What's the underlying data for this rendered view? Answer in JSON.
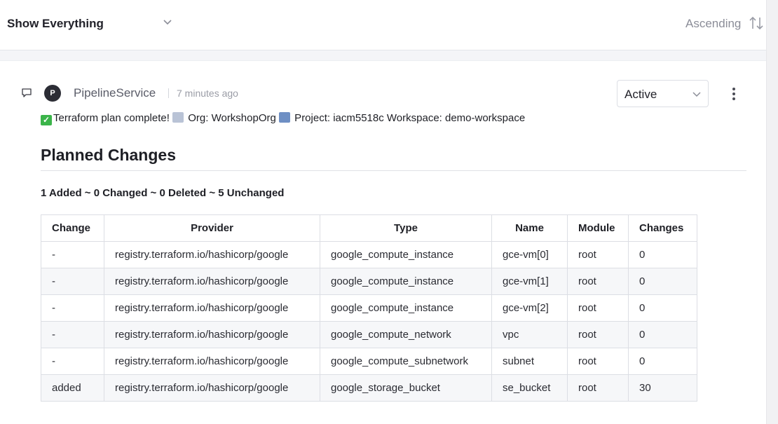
{
  "filter": {
    "label": "Show Everything"
  },
  "sort": {
    "label": "Ascending"
  },
  "comment": {
    "avatar_initial": "P",
    "author": "PipelineService",
    "time": "7 minutes ago",
    "status": "Active",
    "message": {
      "part1": "Terraform plan complete! ",
      "part2": " Org: WorkshopOrg ",
      "part3": " Project: iacm5518c Workspace: demo-workspace"
    },
    "heading": "Planned Changes",
    "summary": "1 Added ~ 0 Changed ~ 0 Deleted ~ 5 Unchanged"
  },
  "table": {
    "headers": [
      "Change",
      "Provider",
      "Type",
      "Name",
      "Module",
      "Changes"
    ],
    "rows": [
      [
        "-",
        "registry.terraform.io/hashicorp/google",
        "google_compute_instance",
        "gce-vm[0]",
        "root",
        "0"
      ],
      [
        "-",
        "registry.terraform.io/hashicorp/google",
        "google_compute_instance",
        "gce-vm[1]",
        "root",
        "0"
      ],
      [
        "-",
        "registry.terraform.io/hashicorp/google",
        "google_compute_instance",
        "gce-vm[2]",
        "root",
        "0"
      ],
      [
        "-",
        "registry.terraform.io/hashicorp/google",
        "google_compute_network",
        "vpc",
        "root",
        "0"
      ],
      [
        "-",
        "registry.terraform.io/hashicorp/google",
        "google_compute_subnetwork",
        "subnet",
        "root",
        "0"
      ],
      [
        "added",
        "registry.terraform.io/hashicorp/google",
        "google_storage_bucket",
        "se_bucket",
        "root",
        "30"
      ]
    ]
  },
  "icons": {
    "filter_chevron": "chevron-down-icon",
    "sort": "sort-arrows-icon",
    "comment": "comment-icon",
    "status_chevron": "chevron-down-icon",
    "kebab": "more-vertical-icon",
    "emoji_1": "check-mark-emoji-icon",
    "emoji_2": "office-building-emoji-icon",
    "emoji_3": "open-book-emoji-icon"
  }
}
